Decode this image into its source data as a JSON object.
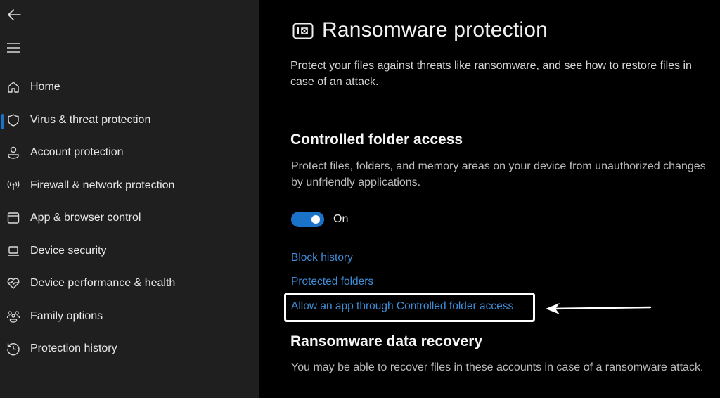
{
  "sidebar": {
    "back_icon": "arrow-left-icon",
    "menu_icon": "hamburger-menu-icon",
    "items": [
      {
        "label": "Home",
        "icon": "home-icon",
        "active": false
      },
      {
        "label": "Virus & threat protection",
        "icon": "shield-icon",
        "active": true
      },
      {
        "label": "Account protection",
        "icon": "person-icon",
        "active": false
      },
      {
        "label": "Firewall & network protection",
        "icon": "wireless-antenna-icon",
        "active": false
      },
      {
        "label": "App & browser control",
        "icon": "browser-window-icon",
        "active": false
      },
      {
        "label": "Device security",
        "icon": "laptop-icon",
        "active": false
      },
      {
        "label": "Device performance & health",
        "icon": "heart-pulse-icon",
        "active": false
      },
      {
        "label": "Family options",
        "icon": "family-icon",
        "active": false
      },
      {
        "label": "Protection history",
        "icon": "history-icon",
        "active": false
      }
    ],
    "accent_color": "#1a73c8"
  },
  "main": {
    "title": "Ransomware protection",
    "title_icon": "ransomware-protection-icon",
    "description": "Protect your files against threats like ransomware, and see how to restore files in case of an attack.",
    "controlled_folder_access": {
      "heading": "Controlled folder access",
      "description": "Protect files, folders, and memory areas on your device from unauthorized changes by unfriendly applications.",
      "toggle_state": "on",
      "toggle_label": "On",
      "links": [
        {
          "label": "Block history"
        },
        {
          "label": "Protected folders"
        },
        {
          "label": "Allow an app through Controlled folder access",
          "highlighted": true
        }
      ]
    },
    "data_recovery": {
      "heading": "Ransomware data recovery",
      "description": "You may be able to recover files in these accounts in case of a ransomware attack."
    },
    "annotation": {
      "type": "arrow",
      "points_to": "Allow an app through Controlled folder access"
    },
    "link_color": "#3f8dd6",
    "toggle_color": "#1a73c8"
  }
}
